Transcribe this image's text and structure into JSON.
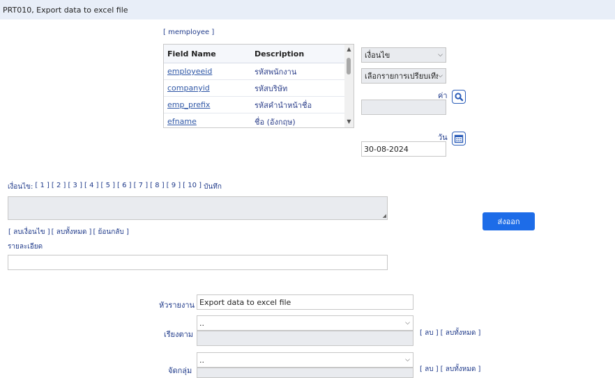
{
  "window": {
    "title": "PRT010, Export data to excel file"
  },
  "table": {
    "label": "[ memployee ]",
    "headers": {
      "field": "Field Name",
      "desc": "Description"
    },
    "rows": [
      {
        "field": "employeeid",
        "desc": "รหัสพนักงาน"
      },
      {
        "field": "companyid",
        "desc": "รหัสบริษัท"
      },
      {
        "field": "emp_prefix",
        "desc": "รหัสคำนำหน้าชื่อ"
      },
      {
        "field": "efname",
        "desc": "ชื่อ (อังกฤษ)"
      }
    ]
  },
  "controls": {
    "condition_select": "เงื่อนไข",
    "compare_select": "เลือกรายการเปรียบเทียบ",
    "value_label": "ค่า",
    "date_label": "วัน",
    "date_value": "30-08-2024"
  },
  "conditions": {
    "label": "เงื่อนไข:",
    "items": [
      "[ 1 ]",
      "[ 2 ]",
      "[ 3 ]",
      "[ 4 ]",
      "[ 5 ]",
      "[ 6 ]",
      "[ 7 ]",
      "[ 8 ]",
      "[ 9 ]",
      "[ 10 ]"
    ],
    "save": "บันทึก"
  },
  "actions": {
    "clear_condition": "[ ลบเงื่อนไข ]",
    "clear_all": "[ ลบทั้งหมด ]",
    "back": "[ ย้อนกลับ ]",
    "export": "ส่งออก"
  },
  "details": {
    "label": "รายละเอียด"
  },
  "report": {
    "header_label": "หัวรายงาน",
    "header_value": "Export data to excel file",
    "sort_label": "เรียงตาม",
    "sort_value": "..",
    "group_label": "จัดกลุ่ม",
    "group_value": "..",
    "remove": "[ ลบ ]",
    "remove_all": "[ ลบทั้งหมด ]"
  },
  "colors": {
    "accent": "#1d6ce8",
    "title_bar": "#e8eef8",
    "link": "#1f3a8a"
  }
}
